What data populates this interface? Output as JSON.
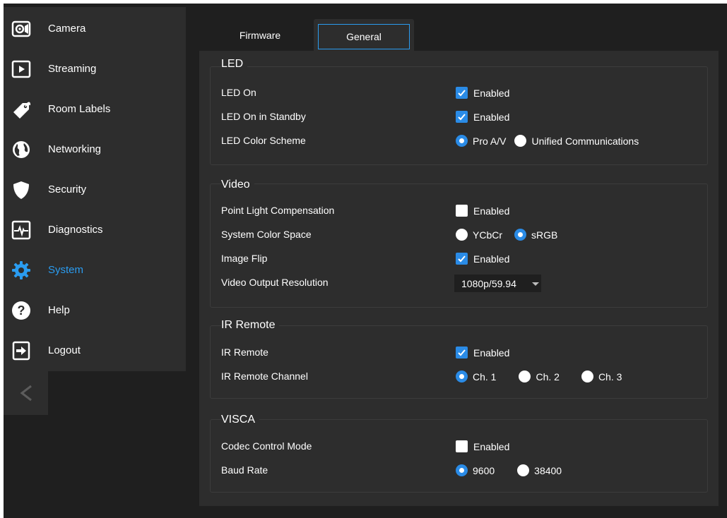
{
  "sidebar": {
    "items": [
      {
        "label": "Camera",
        "icon": "camera-icon"
      },
      {
        "label": "Streaming",
        "icon": "play-icon"
      },
      {
        "label": "Room Labels",
        "icon": "tag-icon"
      },
      {
        "label": "Networking",
        "icon": "globe-icon"
      },
      {
        "label": "Security",
        "icon": "shield-icon"
      },
      {
        "label": "Diagnostics",
        "icon": "pulse-icon"
      },
      {
        "label": "System",
        "icon": "gear-icon",
        "active": true
      },
      {
        "label": "Help",
        "icon": "help-icon"
      },
      {
        "label": "Logout",
        "icon": "logout-icon"
      }
    ],
    "collapse_icon": "chevron-left-icon"
  },
  "tabs": {
    "firmware": "Firmware",
    "general": "General",
    "active": "General"
  },
  "colors": {
    "accent": "#2a9cf0",
    "checkbox_checked": "#2a8be6",
    "panel_bg": "#2d2d2d",
    "page_bg": "#1f1f1f"
  },
  "sections": {
    "led": {
      "title": "LED",
      "led_on": {
        "label": "LED On",
        "option": "Enabled",
        "checked": true
      },
      "led_standby": {
        "label": "LED On in Standby",
        "option": "Enabled",
        "checked": true
      },
      "color_scheme": {
        "label": "LED Color Scheme",
        "options": [
          "Pro A/V",
          "Unified Communications"
        ],
        "selected": "Pro A/V"
      }
    },
    "video": {
      "title": "Video",
      "point_light": {
        "label": "Point Light Compensation",
        "option": "Enabled",
        "checked": false
      },
      "color_space": {
        "label": "System Color Space",
        "options": [
          "YCbCr",
          "sRGB"
        ],
        "selected": "sRGB"
      },
      "image_flip": {
        "label": "Image Flip",
        "option": "Enabled",
        "checked": true
      },
      "output_resolution": {
        "label": "Video Output Resolution",
        "value": "1080p/59.94"
      }
    },
    "ir": {
      "title": "IR Remote",
      "ir_remote": {
        "label": "IR Remote",
        "option": "Enabled",
        "checked": true
      },
      "channel": {
        "label": "IR Remote Channel",
        "options": [
          "Ch. 1",
          "Ch. 2",
          "Ch. 3"
        ],
        "selected": "Ch. 1"
      }
    },
    "visca": {
      "title": "VISCA",
      "codec_control": {
        "label": "Codec Control Mode",
        "option": "Enabled",
        "checked": false
      },
      "baud_rate": {
        "label": "Baud Rate",
        "options": [
          "9600",
          "38400"
        ],
        "selected": "9600"
      }
    }
  }
}
